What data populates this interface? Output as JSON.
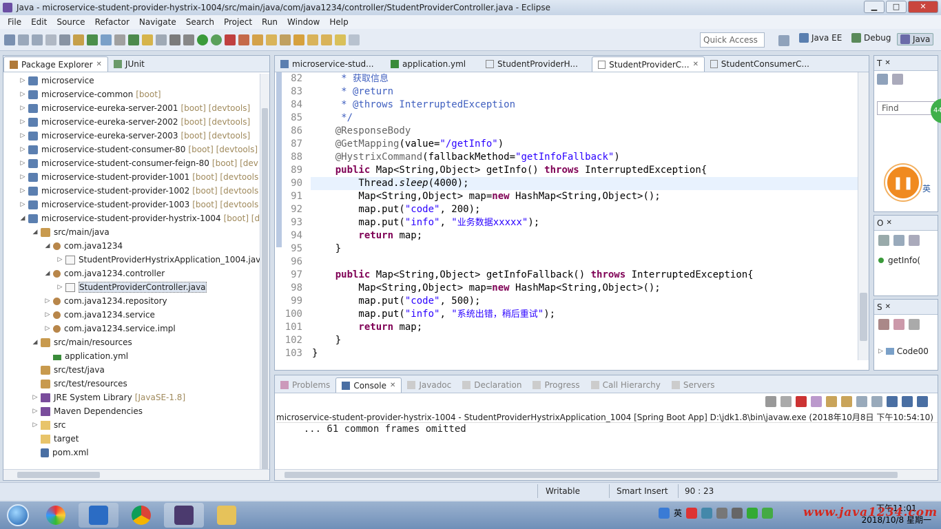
{
  "window": {
    "title": "Java - microservice-student-provider-hystrix-1004/src/main/java/com/java1234/controller/StudentProviderController.java - Eclipse",
    "min": "▁",
    "max": "□",
    "close": "✕"
  },
  "menu": [
    "File",
    "Edit",
    "Source",
    "Refactor",
    "Navigate",
    "Search",
    "Project",
    "Run",
    "Window",
    "Help"
  ],
  "toolbar": {
    "quick_access_placeholder": "Quick Access",
    "perspectives": [
      "Java EE",
      "Debug",
      "Java"
    ]
  },
  "package_explorer": {
    "tabs": [
      "Package Explorer",
      "JUnit"
    ],
    "items": [
      {
        "label": "microservice",
        "deco": "",
        "level": 0,
        "arrow": "▷",
        "icon": "proj"
      },
      {
        "label": "microservice-common",
        "deco": "[boot]",
        "level": 0,
        "arrow": "▷",
        "icon": "proj"
      },
      {
        "label": "microservice-eureka-server-2001",
        "deco": "[boot] [devtools]",
        "level": 0,
        "arrow": "▷",
        "icon": "proj"
      },
      {
        "label": "microservice-eureka-server-2002",
        "deco": "[boot] [devtools]",
        "level": 0,
        "arrow": "▷",
        "icon": "proj"
      },
      {
        "label": "microservice-eureka-server-2003",
        "deco": "[boot] [devtools]",
        "level": 0,
        "arrow": "▷",
        "icon": "proj"
      },
      {
        "label": "microservice-student-consumer-80",
        "deco": "[boot] [devtools]",
        "level": 0,
        "arrow": "▷",
        "icon": "proj"
      },
      {
        "label": "microservice-student-consumer-feign-80",
        "deco": "[boot] [dev",
        "level": 0,
        "arrow": "▷",
        "icon": "proj"
      },
      {
        "label": "microservice-student-provider-1001",
        "deco": "[boot] [devtools",
        "level": 0,
        "arrow": "▷",
        "icon": "proj"
      },
      {
        "label": "microservice-student-provider-1002",
        "deco": "[boot] [devtools",
        "level": 0,
        "arrow": "▷",
        "icon": "proj"
      },
      {
        "label": "microservice-student-provider-1003",
        "deco": "[boot] [devtools",
        "level": 0,
        "arrow": "▷",
        "icon": "proj"
      },
      {
        "label": "microservice-student-provider-hystrix-1004",
        "deco": "[boot] [d",
        "level": 0,
        "arrow": "◢",
        "icon": "proj"
      },
      {
        "label": "src/main/java",
        "deco": "",
        "level": 1,
        "arrow": "◢",
        "icon": "pkgf"
      },
      {
        "label": "com.java1234",
        "deco": "",
        "level": 2,
        "arrow": "◢",
        "icon": "pkg"
      },
      {
        "label": "StudentProviderHystrixApplication_1004.jav",
        "deco": "",
        "level": 3,
        "arrow": "▷",
        "icon": "java"
      },
      {
        "label": "com.java1234.controller",
        "deco": "",
        "level": 2,
        "arrow": "◢",
        "icon": "pkg"
      },
      {
        "label": "StudentProviderController.java",
        "deco": "",
        "level": 3,
        "arrow": "▷",
        "icon": "java",
        "selected": true
      },
      {
        "label": "com.java1234.repository",
        "deco": "",
        "level": 2,
        "arrow": "▷",
        "icon": "pkg"
      },
      {
        "label": "com.java1234.service",
        "deco": "",
        "level": 2,
        "arrow": "▷",
        "icon": "pkg"
      },
      {
        "label": "com.java1234.service.impl",
        "deco": "",
        "level": 2,
        "arrow": "▷",
        "icon": "pkg"
      },
      {
        "label": "src/main/resources",
        "deco": "",
        "level": 1,
        "arrow": "◢",
        "icon": "pkgf"
      },
      {
        "label": "application.yml",
        "deco": "",
        "level": 2,
        "arrow": "",
        "icon": "yml"
      },
      {
        "label": "src/test/java",
        "deco": "",
        "level": 1,
        "arrow": "",
        "icon": "pkgf"
      },
      {
        "label": "src/test/resources",
        "deco": "",
        "level": 1,
        "arrow": "",
        "icon": "pkgf"
      },
      {
        "label": "JRE System Library",
        "deco": "[JavaSE-1.8]",
        "level": 1,
        "arrow": "▷",
        "icon": "lib"
      },
      {
        "label": "Maven Dependencies",
        "deco": "",
        "level": 1,
        "arrow": "▷",
        "icon": "lib"
      },
      {
        "label": "src",
        "deco": "",
        "level": 1,
        "arrow": "▷",
        "icon": "fold"
      },
      {
        "label": "target",
        "deco": "",
        "level": 1,
        "arrow": "",
        "icon": "fold"
      },
      {
        "label": "pom.xml",
        "deco": "",
        "level": 1,
        "arrow": "",
        "icon": "pom"
      }
    ]
  },
  "editor": {
    "tabs": [
      {
        "label": "microservice-stud...",
        "active": false
      },
      {
        "label": "application.yml",
        "active": false
      },
      {
        "label": "StudentProviderH...",
        "active": false
      },
      {
        "label": "StudentProviderC...",
        "active": true
      },
      {
        "label": "StudentConsumerC...",
        "active": false
      }
    ],
    "current_line": "90",
    "lines": [
      {
        "n": "82",
        "segs": [
          [
            "cmt",
            "     * "
          ],
          [
            "cmt cjk",
            "获取信息"
          ]
        ]
      },
      {
        "n": "83",
        "segs": [
          [
            "cmt",
            "     * @return"
          ]
        ]
      },
      {
        "n": "84",
        "segs": [
          [
            "cmt",
            "     * @throws InterruptedException"
          ]
        ]
      },
      {
        "n": "85",
        "segs": [
          [
            "cmt",
            "     */"
          ]
        ]
      },
      {
        "n": "86",
        "segs": [
          [
            "ann",
            "    @ResponseBody"
          ]
        ]
      },
      {
        "n": "87",
        "segs": [
          [
            "ann",
            "    @GetMapping"
          ],
          [
            "",
            "(value="
          ],
          [
            "str",
            "\"/getInfo\""
          ],
          [
            "",
            ")"
          ]
        ]
      },
      {
        "n": "88",
        "segs": [
          [
            "ann",
            "    @HystrixCommand"
          ],
          [
            "",
            "(fallbackMethod="
          ],
          [
            "str",
            "\"getInfoFallback\""
          ],
          [
            "",
            ")"
          ]
        ]
      },
      {
        "n": "89",
        "segs": [
          [
            "kw",
            "    public "
          ],
          [
            "",
            "Map<String,Object> getInfo() "
          ],
          [
            "kw",
            "throws "
          ],
          [
            "",
            "InterruptedException{"
          ]
        ]
      },
      {
        "n": "90",
        "segs": [
          [
            "",
            "        Thread."
          ],
          [
            "it",
            "sleep"
          ],
          [
            "",
            "(4000);"
          ]
        ]
      },
      {
        "n": "91",
        "segs": [
          [
            "",
            "        Map<String,Object> map="
          ],
          [
            "kw",
            "new "
          ],
          [
            "",
            "HashMap<String,Object>();"
          ]
        ]
      },
      {
        "n": "92",
        "segs": [
          [
            "",
            "        map.put("
          ],
          [
            "str",
            "\"code\""
          ],
          [
            "",
            ", 200);"
          ]
        ]
      },
      {
        "n": "93",
        "segs": [
          [
            "",
            "        map.put("
          ],
          [
            "str",
            "\"info\""
          ],
          [
            "",
            ", "
          ],
          [
            "str",
            "\""
          ],
          [
            "str cjk",
            "业务数据"
          ],
          [
            "str",
            "xxxxx\""
          ],
          [
            "",
            ");"
          ]
        ]
      },
      {
        "n": "94",
        "segs": [
          [
            "kw",
            "        return "
          ],
          [
            "",
            "map;"
          ]
        ]
      },
      {
        "n": "95",
        "segs": [
          [
            "",
            "    }"
          ]
        ]
      },
      {
        "n": "96",
        "segs": [
          [
            "",
            ""
          ]
        ]
      },
      {
        "n": "97",
        "segs": [
          [
            "kw",
            "    public "
          ],
          [
            "",
            "Map<String,Object> getInfoFallback() "
          ],
          [
            "kw",
            "throws "
          ],
          [
            "",
            "InterruptedException{"
          ]
        ]
      },
      {
        "n": "98",
        "segs": [
          [
            "",
            "        Map<String,Object> map="
          ],
          [
            "kw",
            "new "
          ],
          [
            "",
            "HashMap<String,Object>();"
          ]
        ]
      },
      {
        "n": "99",
        "segs": [
          [
            "",
            "        map.put("
          ],
          [
            "str",
            "\"code\""
          ],
          [
            "",
            ", 500);"
          ]
        ]
      },
      {
        "n": "100",
        "segs": [
          [
            "",
            "        map.put("
          ],
          [
            "str",
            "\"info\""
          ],
          [
            "",
            ", "
          ],
          [
            "str",
            "\""
          ],
          [
            "str cjk",
            "系统出错，稍后重试"
          ],
          [
            "str",
            "\""
          ],
          [
            "",
            ");"
          ]
        ]
      },
      {
        "n": "101",
        "segs": [
          [
            "kw",
            "        return "
          ],
          [
            "",
            "map;"
          ]
        ]
      },
      {
        "n": "102",
        "segs": [
          [
            "",
            "    }"
          ]
        ]
      },
      {
        "n": "103",
        "segs": [
          [
            "",
            "}"
          ]
        ]
      }
    ]
  },
  "right_panels": {
    "task_tab": "T",
    "find_placeholder": "Find",
    "outline_tab": "O",
    "outline_item": "getInfo(",
    "servers_tab": "S",
    "servers_item": "Code00",
    "ime_label": "英",
    "green_badge": "44"
  },
  "console": {
    "tabs": [
      "Problems",
      "Console",
      "Javadoc",
      "Declaration",
      "Progress",
      "Call Hierarchy",
      "Servers"
    ],
    "header": "microservice-student-provider-hystrix-1004 - StudentProviderHystrixApplication_1004 [Spring Boot App] D:\\jdk1.8\\bin\\javaw.exe (2018年10月8日 下午10:54:10)",
    "output": "    ... 61 common frames omitted"
  },
  "status": {
    "writable": "Writable",
    "insert_mode": "Smart Insert",
    "position": "90 : 23"
  },
  "taskbar": {
    "ime": "英",
    "time": "下午11:01",
    "date": "2018/10/8 星期一",
    "watermark": "www.java1234.com"
  }
}
